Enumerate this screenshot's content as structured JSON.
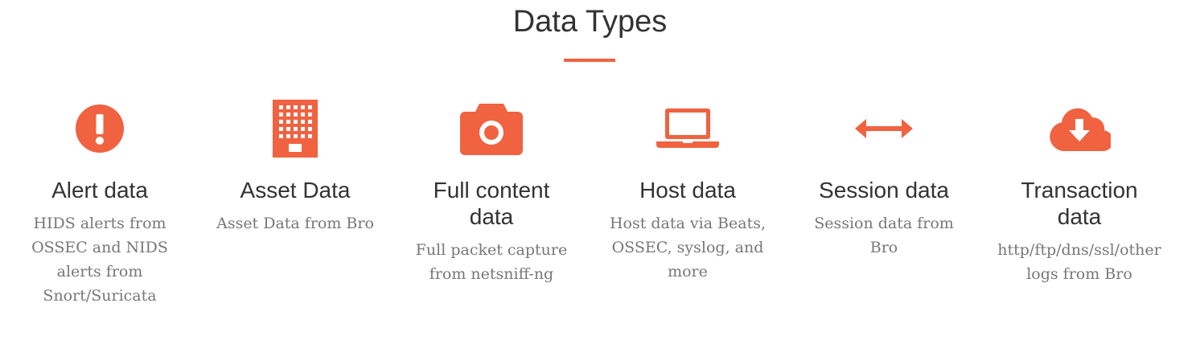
{
  "section": {
    "title": "Data Types",
    "accent_color": "#f06240"
  },
  "items": [
    {
      "icon": "exclamation-circle-icon",
      "title": "Alert data",
      "description": "HIDS alerts from OSSEC and NIDS alerts from Snort/Suricata"
    },
    {
      "icon": "building-icon",
      "title": "Asset Data",
      "description": "Asset Data from Bro"
    },
    {
      "icon": "camera-icon",
      "title": "Full content data",
      "description": "Full packet capture from netsniff-ng"
    },
    {
      "icon": "laptop-icon",
      "title": "Host data",
      "description": "Host data via Beats, OSSEC, syslog, and more"
    },
    {
      "icon": "arrows-horizontal-icon",
      "title": "Session data",
      "description": "Session data from Bro"
    },
    {
      "icon": "cloud-download-icon",
      "title": "Transaction data",
      "description": "http/ftp/dns/ssl/other logs from Bro"
    }
  ]
}
